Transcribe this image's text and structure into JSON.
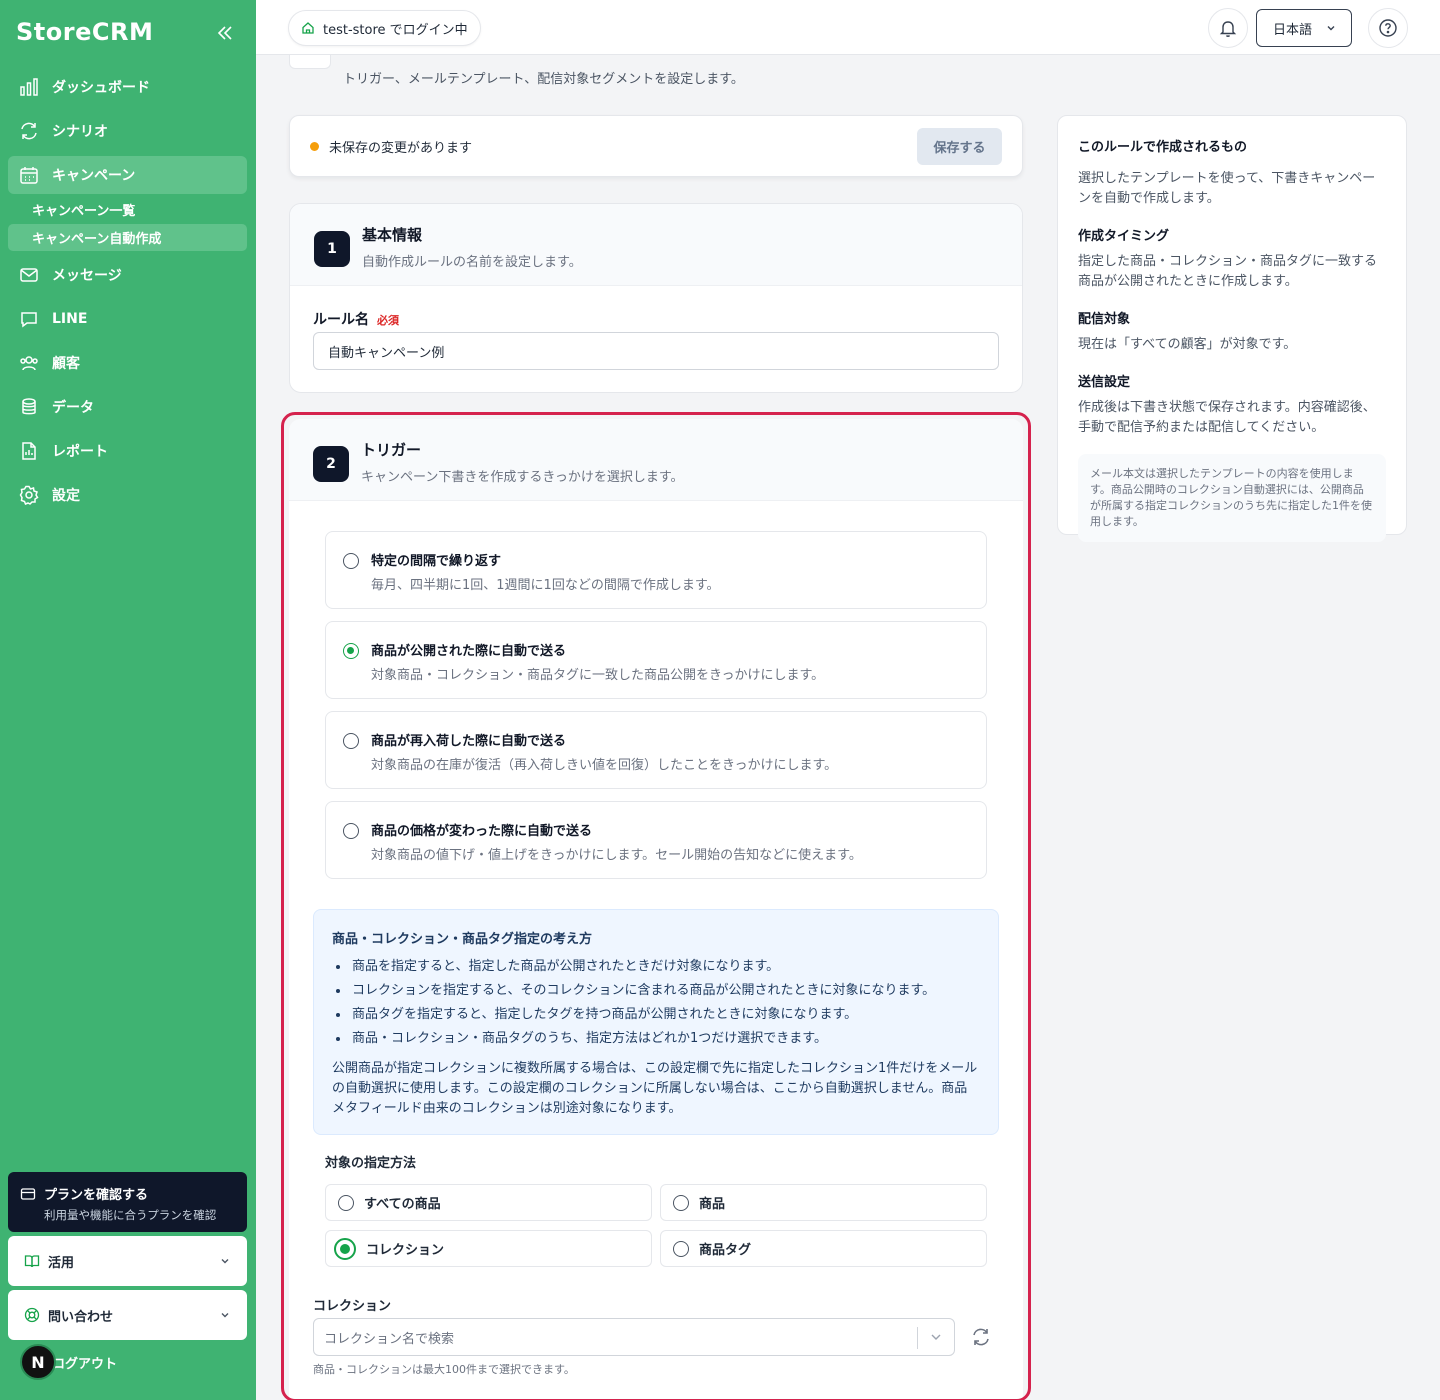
{
  "app": {
    "brand": "StoreCRM"
  },
  "sidebar": {
    "items": [
      {
        "label": "ダッシュボード",
        "icon": "chart-bars-icon"
      },
      {
        "label": "シナリオ",
        "icon": "refresh-icon"
      },
      {
        "label": "キャンペーン",
        "icon": "calendar-icon"
      },
      {
        "label": "メッセージ",
        "icon": "mail-icon"
      },
      {
        "label": "LINE",
        "icon": "chat-icon"
      },
      {
        "label": "顧客",
        "icon": "users-icon"
      },
      {
        "label": "データ",
        "icon": "database-icon"
      },
      {
        "label": "レポート",
        "icon": "document-icon"
      },
      {
        "label": "設定",
        "icon": "gear-icon"
      }
    ],
    "sub_items": [
      "キャンペーン一覧",
      "キャンペーン自動作成"
    ],
    "plan": {
      "title": "プランを確認する",
      "subtitle": "利用量や機能に合うプランを確認"
    },
    "usage": "活用",
    "contact": "問い合わせ",
    "logout": "ログアウト",
    "avatar_letter": "N"
  },
  "topbar": {
    "store": "test-store でログイン中",
    "language": "日本語"
  },
  "page": {
    "description": "トリガー、メールテンプレート、配信対象セグメントを設定します。"
  },
  "unsaved": {
    "text": "未保存の変更があります",
    "save": "保存する"
  },
  "basic": {
    "step": "1",
    "title": "基本情報",
    "desc": "自動作成ルールの名前を設定します。",
    "rule_label": "ルール名",
    "required": "必須",
    "rule_value": "自動キャンペーン例"
  },
  "trigger": {
    "step": "2",
    "title": "トリガー",
    "desc": "キャンペーン下書きを作成するきっかけを選択します。",
    "options": [
      {
        "title": "特定の間隔で繰り返す",
        "desc": "毎月、四半期に1回、1週間に1回などの間隔で作成します。"
      },
      {
        "title": "商品が公開された際に自動で送る",
        "desc": "対象商品・コレクション・商品タグに一致した商品公開をきっかけにします。"
      },
      {
        "title": "商品が再入荷した際に自動で送る",
        "desc": "対象商品の在庫が復活（再入荷しきい値を回復）したことをきっかけにします。"
      },
      {
        "title": "商品の価格が変わった際に自動で送る",
        "desc": "対象商品の値下げ・値上げをきっかけにします。セール開始の告知などに使えます。"
      }
    ],
    "selected_option": 1,
    "info": {
      "title": "商品・コレクション・商品タグ指定の考え方",
      "bullets": [
        "商品を指定すると、指定した商品が公開されたときだけ対象になります。",
        "コレクションを指定すると、そのコレクションに含まれる商品が公開されたときに対象になります。",
        "商品タグを指定すると、指定したタグを持つ商品が公開されたときに対象になります。",
        "商品・コレクション・商品タグのうち、指定方法はどれか1つだけ選択できます。"
      ],
      "note": "公開商品が指定コレクションに複数所属する場合は、この設定欄で先に指定したコレクション1件だけをメールの自動選択に使用します。この設定欄のコレクションに所属しない場合は、ここから自動選択しません。商品メタフィールド由来のコレクションは別途対象になります。"
    },
    "method_label": "対象の指定方法",
    "methods": [
      "すべての商品",
      "商品",
      "コレクション",
      "商品タグ"
    ],
    "selected_method": "コレクション",
    "collection_label": "コレクション",
    "collection_placeholder": "コレクション名で検索",
    "collection_hint": "商品・コレクションは最大100件まで選択できます。"
  },
  "right_panel": {
    "heading": "このルールで作成されるもの",
    "intro": "選択したテンプレートを使って、下書きキャンペーンを自動で作成します。",
    "sections": [
      {
        "title": "作成タイミング",
        "text": "指定した商品・コレクション・商品タグに一致する商品が公開されたときに作成します。"
      },
      {
        "title": "配信対象",
        "text": "現在は「すべての顧客」が対象です。"
      },
      {
        "title": "送信設定",
        "text": "作成後は下書き状態で保存されます。内容確認後、手動で配信予約または配信してください。"
      }
    ],
    "note": "メール本文は選択したテンプレートの内容を使用します。商品公開時のコレクション自動選択には、公開商品が所属する指定コレクションのうち先に指定した1件を使用します。"
  },
  "colors": {
    "sidebar": "#3fb372",
    "accent_selected": "#16a34a",
    "highlight_frame": "#d5224d",
    "warning_dot": "#f59e0b"
  }
}
